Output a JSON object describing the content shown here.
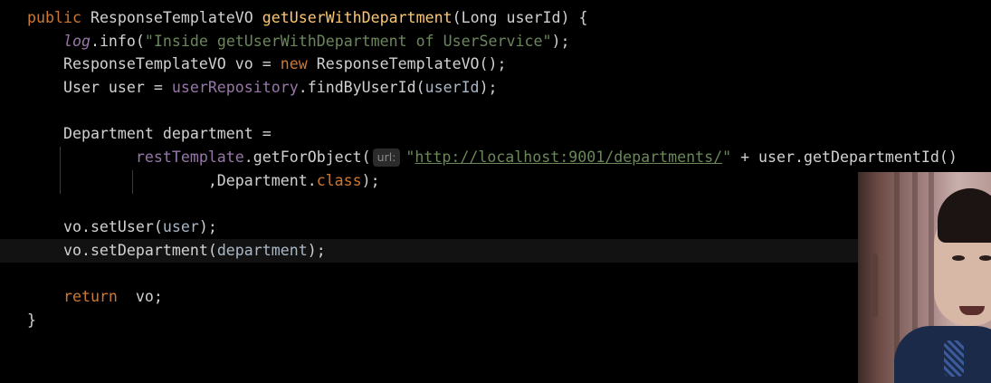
{
  "code": {
    "line1": {
      "kw_public": "public",
      "type_return": "ResponseTemplateVO",
      "method": "getUserWithDepartment",
      "open": "(",
      "param_type": "Long",
      "param_name": "userId",
      "close": ") {"
    },
    "line2": {
      "log": "log",
      "call": ".info(",
      "string": "\"Inside getUserWithDepartment of UserService\"",
      "end": ");"
    },
    "line3": {
      "decl": "ResponseTemplateVO vo = ",
      "kw_new": "new",
      "ctor": " ResponseTemplateVO();"
    },
    "line4": {
      "decl": "User user = ",
      "repo": "userRepository",
      "call": ".findByUserId(",
      "arg": "userId",
      "end": ");"
    },
    "line6": {
      "decl": "Department department ="
    },
    "line7": {
      "rest": "restTemplate",
      "call": ".getForObject(",
      "hint": "url:",
      "quote_open": "\"",
      "url": "http://localhost:9001/departments/",
      "quote_close": "\"",
      "rest_expr": " + user.getDepartmentId()"
    },
    "line8": {
      "prefix": ",Department.",
      "kw_class": "class",
      "end": ");"
    },
    "line10": {
      "obj": "vo",
      "call": ".setUser(",
      "arg": "user",
      "end": ");"
    },
    "line11": {
      "obj": "vo",
      "call": ".setDepartment(",
      "arg": "department",
      "end": ");"
    },
    "line13": {
      "kw_return": "return",
      "val": "  vo;"
    },
    "line14": {
      "brace": "}"
    }
  }
}
